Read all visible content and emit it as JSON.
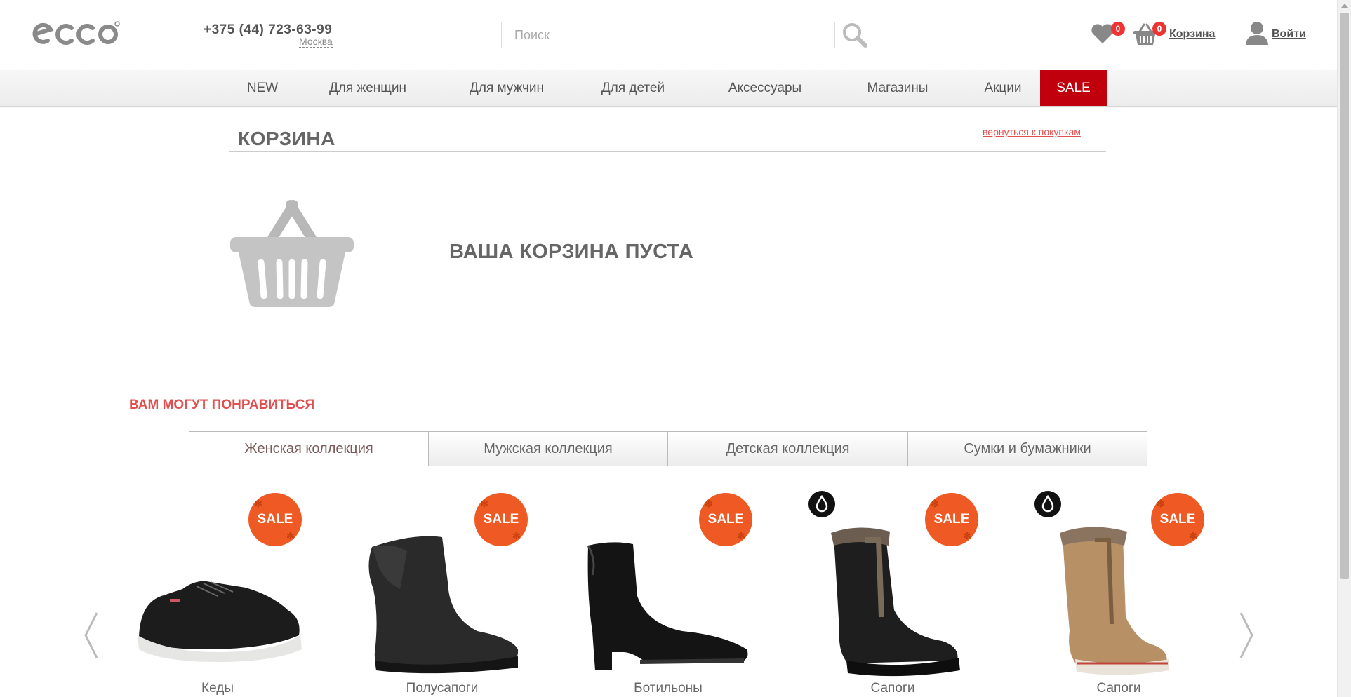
{
  "header": {
    "logo_text": "ecco",
    "phone": "+375 (44) 723-63-99",
    "city": "Москва",
    "search_placeholder": "Поиск",
    "favorites_count": "0",
    "cart_count": "0",
    "cart_label": "Корзина",
    "login_label": "Войти"
  },
  "nav": {
    "items": [
      {
        "label": "NEW"
      },
      {
        "label": "Для женщин"
      },
      {
        "label": "Для мужчин"
      },
      {
        "label": "Для детей"
      },
      {
        "label": "Аксессуары"
      },
      {
        "label": "Магазины"
      },
      {
        "label": "Акции"
      },
      {
        "label": "SALE"
      }
    ]
  },
  "cart": {
    "title": "КОРЗИНА",
    "back_link": "вернуться к покупкам",
    "empty_message": "ВАША КОРЗИНА ПУСТА"
  },
  "recommendations": {
    "title": "ВАМ МОГУТ ПОНРАВИТЬСЯ",
    "tabs": [
      {
        "label": "Женская коллекция",
        "active": true
      },
      {
        "label": "Мужская коллекция",
        "active": false
      },
      {
        "label": "Детская коллекция",
        "active": false
      },
      {
        "label": "Сумки и бумажники",
        "active": false
      }
    ],
    "sale_badge_text": "SALE",
    "products": [
      {
        "name": "Кеды",
        "sale": true,
        "waterproof": false,
        "color": "#1c1c1c"
      },
      {
        "name": "Полусапоги",
        "sale": true,
        "waterproof": false,
        "color": "#2a2a2a"
      },
      {
        "name": "Ботильоны",
        "sale": true,
        "waterproof": false,
        "color": "#141414"
      },
      {
        "name": "Сапоги",
        "sale": true,
        "waterproof": true,
        "color": "#1e1e1e"
      },
      {
        "name": "Сапоги",
        "sale": true,
        "waterproof": true,
        "color": "#b89066"
      }
    ]
  },
  "colors": {
    "accent_red": "#c0000c",
    "link_red": "#e05050",
    "sale_orange": "#ef5a24",
    "badge_red": "#e33"
  }
}
